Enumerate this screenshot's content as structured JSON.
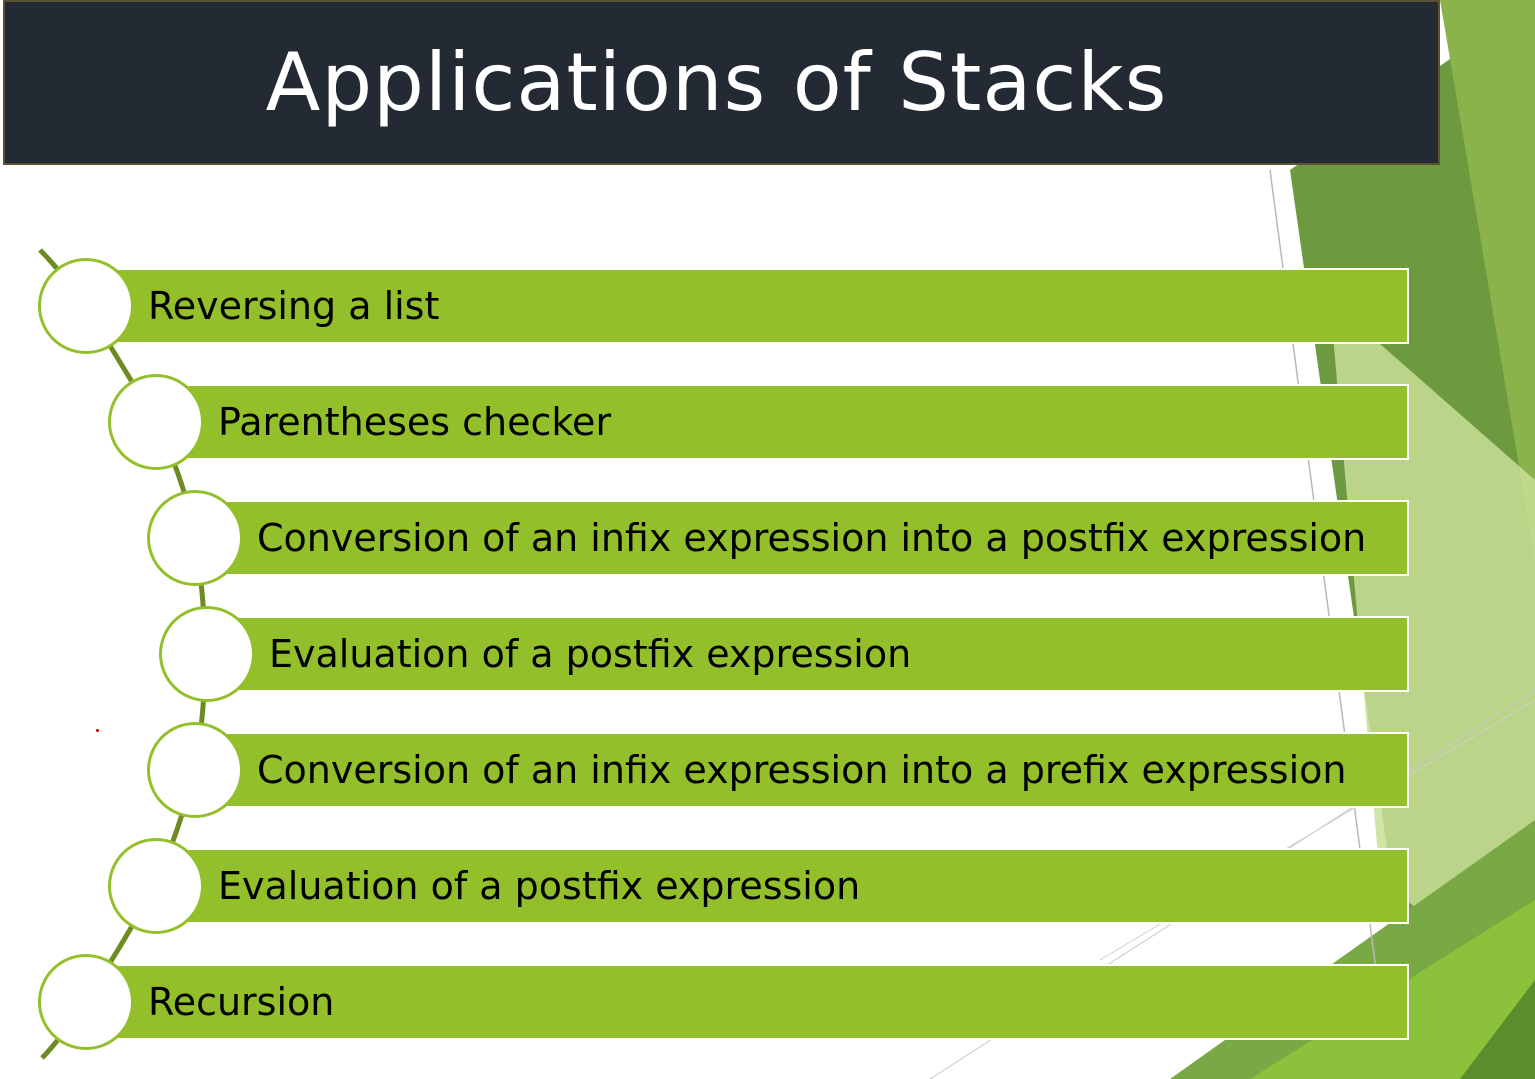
{
  "slide": {
    "title": "Applications of  Stacks",
    "items": [
      "Reversing a list",
      "Parentheses checker",
      "Conversion of an infix expression into a postfix expression",
      "Evaluation of a postfix expression",
      "Conversion of an infix expression into a prefix expression",
      "Evaluation of a postfix expression",
      "Recursion"
    ]
  },
  "colors": {
    "title_bg": "#242a33",
    "bar_fill": "#93c02a",
    "accent_dark": "#5f8f30",
    "accent_light": "#c9df9a"
  }
}
